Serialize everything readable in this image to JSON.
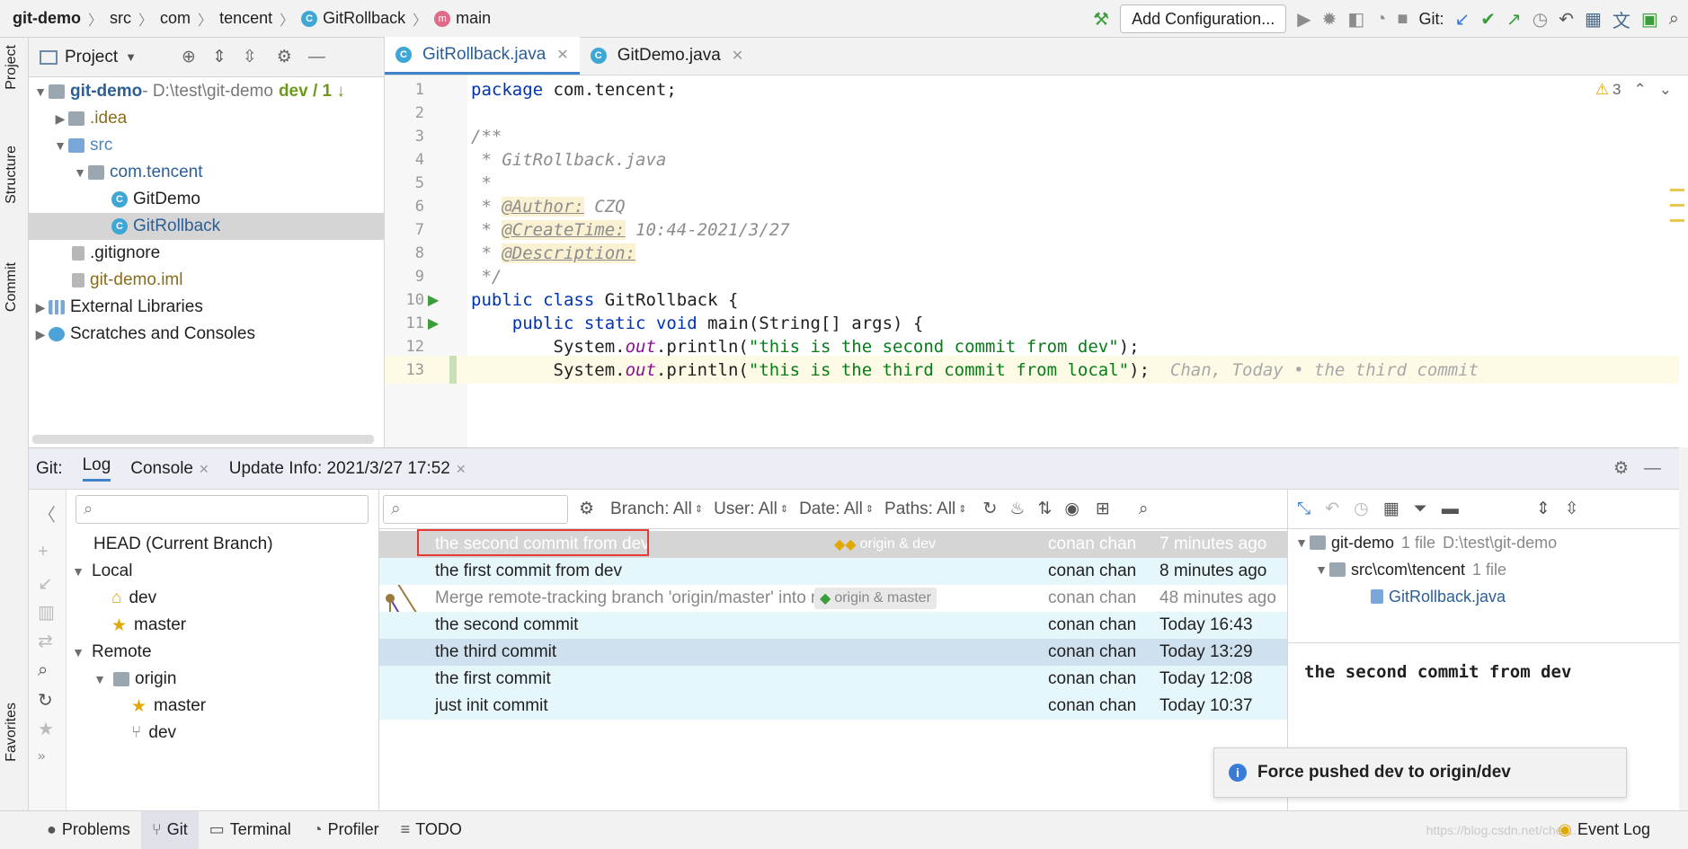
{
  "navbar": {
    "breadcrumbs": [
      "git-demo",
      "src",
      "com",
      "tencent",
      "GitRollback",
      "main"
    ],
    "add_config": "Add Configuration...",
    "git_label": "Git:"
  },
  "left_strip": {
    "project": "Project",
    "structure": "Structure",
    "commit": "Commit",
    "favorites": "Favorites"
  },
  "project": {
    "header": "Project",
    "tree": [
      {
        "label": "git-demo",
        "extra": " - D:\\test\\git-demo",
        "branch": "dev / 1 ↓"
      },
      {
        "label": ".idea"
      },
      {
        "label": "src"
      },
      {
        "label": "com.tencent"
      },
      {
        "label": "GitDemo"
      },
      {
        "label": "GitRollback"
      },
      {
        "label": ".gitignore"
      },
      {
        "label": "git-demo.iml"
      },
      {
        "label": "External Libraries"
      },
      {
        "label": "Scratches and Consoles"
      }
    ]
  },
  "editor": {
    "tabs": [
      {
        "label": "GitRollback.java"
      },
      {
        "label": "GitDemo.java"
      }
    ],
    "warning_count": "3",
    "lines": [
      "1",
      "2",
      "3",
      "4",
      "5",
      "6",
      "7",
      "8",
      "9",
      "10",
      "11",
      "12",
      "13"
    ],
    "code": {
      "l1_kw": "package",
      "l1_rest": " com.tencent;",
      "l3": "/**",
      "l4": " * GitRollback.java",
      "l5": " *",
      "l6_pre": " * ",
      "l6_tag": "@Author:",
      "l6_val": " CZQ",
      "l7_tag": "@CreateTime:",
      "l7_val": " 10:44-2021/3/27",
      "l8_tag": "@Description:",
      "l9": " */",
      "l10_kw": "public class",
      "l10_rest": " GitRollback {",
      "l11_kw": "public static void",
      "l11_rest": " main(String[] args) {",
      "l12_pre": "System.",
      "l12_out": "out",
      "l12_mid": ".println(",
      "l12_str": "\"this is the second commit from dev\"",
      "l12_end": ");",
      "l13_str": "\"this is the third commit from local\"",
      "l13_blame": "Chan, Today • the third commit"
    }
  },
  "git": {
    "tabs": {
      "git": "Git:",
      "log": "Log",
      "console": "Console",
      "update": "Update Info: 2021/3/27 17:52"
    },
    "branches": {
      "head": "HEAD (Current Branch)",
      "local": "Local",
      "dev": "dev",
      "master": "master",
      "remote": "Remote",
      "origin": "origin",
      "origin_master": "master",
      "origin_dev": "dev"
    },
    "filters": {
      "branch": "Branch: All",
      "user": "User: All",
      "date": "Date: All",
      "paths": "Paths: All"
    },
    "commits": [
      {
        "msg": "the second  commit from dev",
        "ref": "origin & dev",
        "author": "conan chan",
        "date": "7 minutes ago"
      },
      {
        "msg": "the first  commit from dev",
        "ref": "",
        "author": "conan chan",
        "date": "8 minutes ago"
      },
      {
        "msg": "Merge remote-tracking branch 'origin/master' into master",
        "ref": "origin & master",
        "author": "conan chan",
        "date": "48 minutes ago"
      },
      {
        "msg": "the second commit",
        "ref": "",
        "author": "conan chan",
        "date": "Today 16:43"
      },
      {
        "msg": "the third commit",
        "ref": "",
        "author": "conan chan",
        "date": "Today 13:29"
      },
      {
        "msg": "the first commit",
        "ref": "",
        "author": "conan chan",
        "date": "Today 12:08"
      },
      {
        "msg": "just init commit",
        "ref": "",
        "author": "conan chan",
        "date": "Today 10:37"
      }
    ],
    "details": {
      "root": "git-demo",
      "root_count": "1 file",
      "root_path": "D:\\test\\git-demo",
      "folder": "src\\com\\tencent",
      "folder_count": "1 file",
      "file": "GitRollback.java",
      "commit_title": "the second  commit from dev"
    }
  },
  "notification": "Force pushed dev to origin/dev",
  "statusbar": {
    "problems": "Problems",
    "git": "Git",
    "terminal": "Terminal",
    "profiler": "Profiler",
    "todo": "TODO",
    "event_log": "Event Log",
    "watermark": "https://blog.csdn.net/chen..."
  }
}
